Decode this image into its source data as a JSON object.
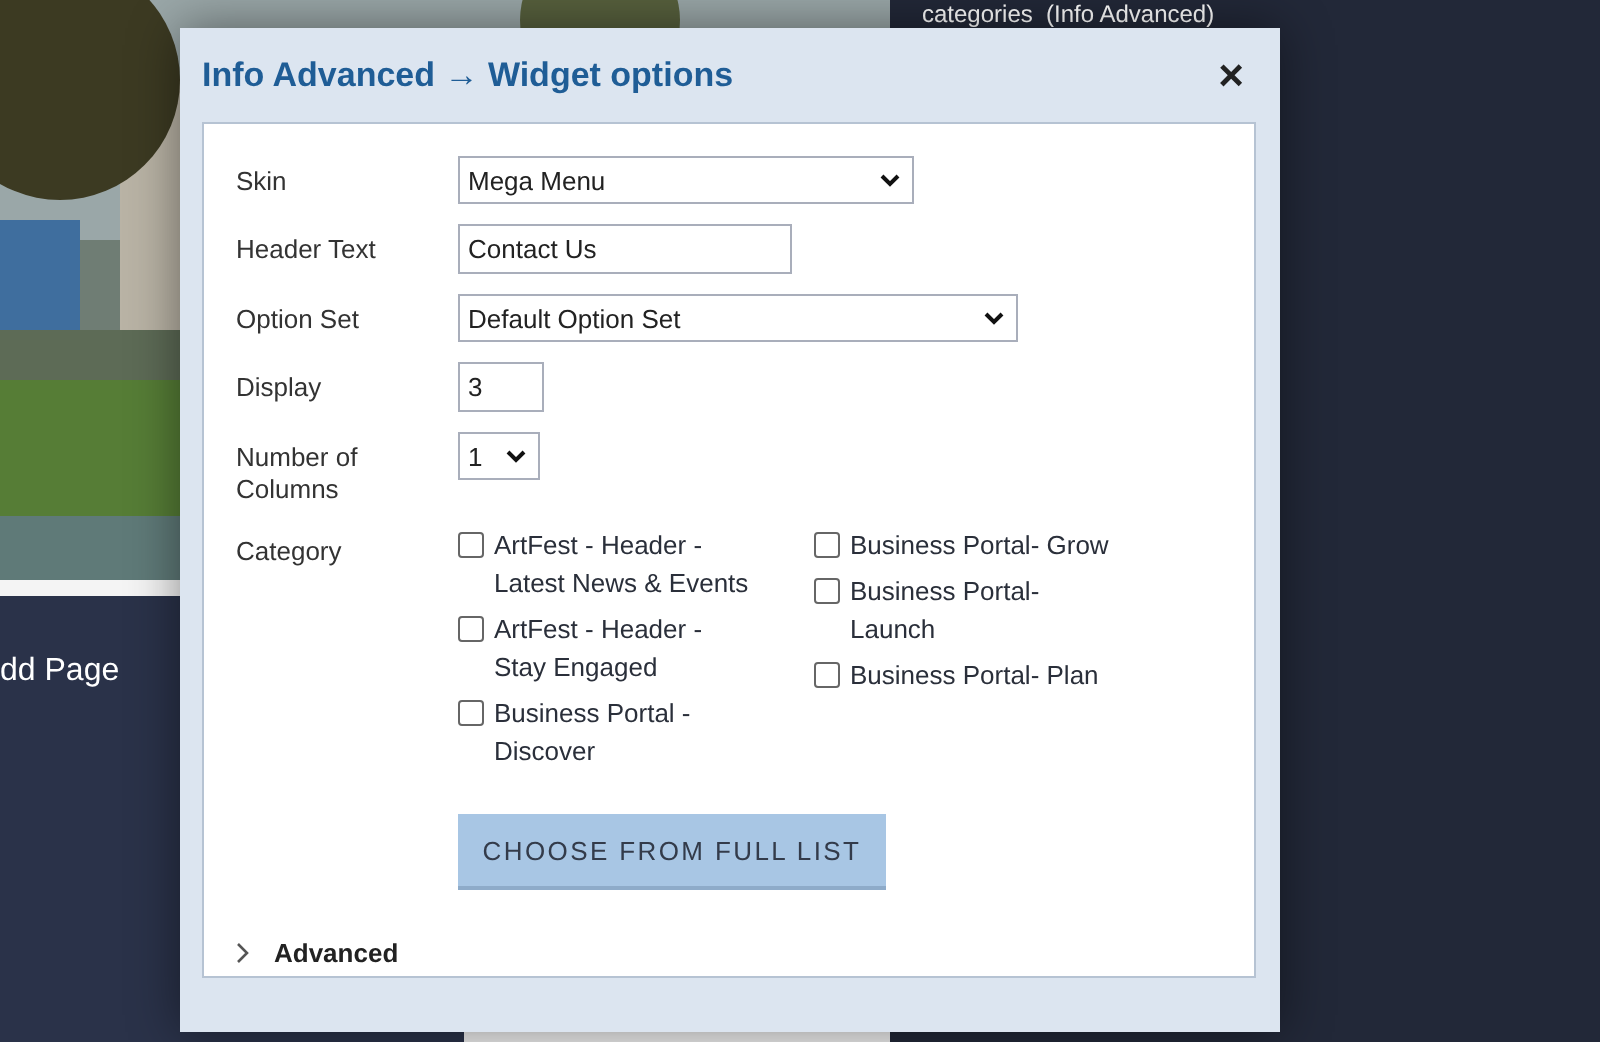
{
  "background": {
    "link": "dd Page",
    "heading": "categories  (Info Advanced)"
  },
  "dialog": {
    "title": "Info Advanced → Widget options",
    "close": "×",
    "fields": [
      {
        "kind": "select",
        "label": "Skin",
        "value": "Mega Menu"
      },
      {
        "kind": "text",
        "label": "Header Text",
        "value": "Contact Us"
      },
      {
        "kind": "select",
        "label": "Option Set",
        "value": "Default Option Set"
      },
      {
        "kind": "text",
        "label": "Display",
        "value": "3"
      },
      {
        "kind": "select",
        "label": "Number of Columns",
        "value": "1"
      }
    ],
    "category": {
      "label": "Category",
      "columns": [
        [
          {
            "label": "ArtFest - Header - Latest News & Events",
            "checked": false
          },
          {
            "label": "ArtFest - Header - Stay Engaged",
            "checked": false
          },
          {
            "label": "Business Portal - Discover",
            "checked": false
          }
        ],
        [
          {
            "label": "Business Portal- Grow",
            "checked": false
          },
          {
            "label": "Business Portal- Launch",
            "checked": false
          },
          {
            "label": "Business Portal- Plan",
            "checked": false
          }
        ]
      ],
      "button": "CHOOSE FROM FULL LIST"
    },
    "advanced": {
      "label": "Advanced",
      "expanded": false
    }
  }
}
